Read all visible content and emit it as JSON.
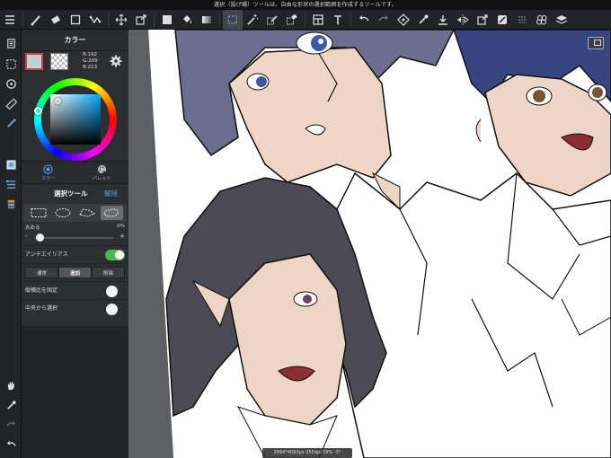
{
  "status_bar": {
    "message": "選択（投げ縄）ツールは、自由な形状の選択範囲を作成するツールです。"
  },
  "toolbar": {
    "left_icons": [
      "menu-icon",
      "brush-icon",
      "eraser-icon",
      "rectangle-icon",
      "transform-icon",
      "move-icon",
      "transform-box-icon"
    ],
    "mid_icons": [
      "fill-color-icon",
      "bucket-icon",
      "gradient-icon",
      "select-rect-icon",
      "magic-wand-icon",
      "select-pen-icon",
      "select-eraser-icon",
      "panel-icon",
      "text-icon"
    ],
    "right_icons": [
      "undo-icon",
      "redo-icon",
      "transform-icon",
      "eyedropper-icon",
      "import-icon",
      "flip-icon",
      "share-icon",
      "filter-icon",
      "grid-icon",
      "materials-icon",
      "layers-icon"
    ]
  },
  "rail_icons": [
    "pages-icon",
    "selection-icon",
    "rotate-icon",
    "ruler-icon",
    "snap-icon",
    "color-panel-icon",
    "brush-panel-icon",
    "layer-panel-icon",
    "hand-icon",
    "eyedropper-icon",
    "redo-icon",
    "undo-icon"
  ],
  "panel": {
    "title": "カラー",
    "rgb": {
      "r": "R:192",
      "g": "G:209",
      "b": "B:213"
    },
    "main_color": "#c0d1d5",
    "tabs": [
      {
        "label": "カラー",
        "icon": "color-wheel-icon",
        "active": true
      },
      {
        "label": "パレット",
        "icon": "palette-icon",
        "active": false
      }
    ],
    "tool_title": "選択ツール",
    "release": "解除",
    "shapes": [
      "rect-select-icon",
      "ellipse-select-icon",
      "lasso-icon",
      "polygon-lasso-icon"
    ],
    "round_label": "丸める",
    "round_value": "0%",
    "minus": "-",
    "plus": "+",
    "antialias_label": "アンチエイリアス",
    "modes": [
      {
        "label": "通常",
        "active": false
      },
      {
        "label": "追加",
        "active": true
      },
      {
        "label": "削除",
        "active": false
      }
    ],
    "fix_ratio_label": "縦横比を固定",
    "from_center_label": "中央から選択"
  },
  "info_bar": {
    "text": "2894*4093px 350dpi 59% -3°"
  },
  "colors": {
    "accent": "#4d9de8",
    "toggle_on": "#4cbb4c",
    "panel_bg": "#2d2e31"
  }
}
